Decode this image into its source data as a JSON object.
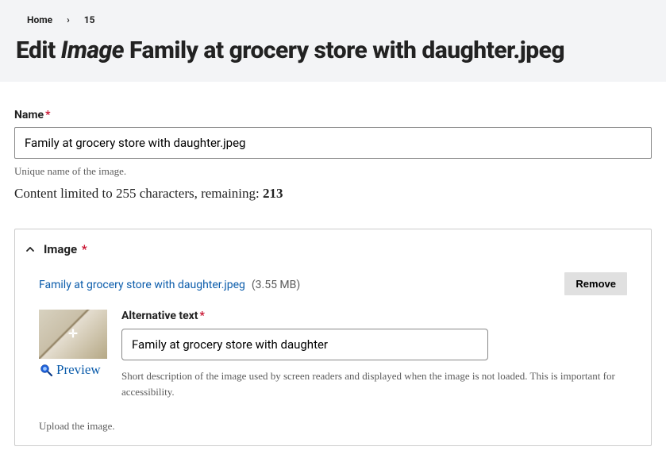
{
  "breadcrumb": {
    "home": "Home",
    "current": "15"
  },
  "page_title": {
    "prefix": "Edit",
    "type": "Image",
    "name": "Family at grocery store with daughter.jpeg"
  },
  "name_field": {
    "label": "Name",
    "value": "Family at grocery store with daughter.jpeg",
    "help": "Unique name of the image.",
    "counter_prefix": "Content limited to 255 characters, remaining: ",
    "remaining": "213"
  },
  "image_panel": {
    "title": "Image",
    "file_link": "Family at grocery store with daughter.jpeg",
    "file_size": "(3.55 MB)",
    "remove_label": "Remove",
    "preview_label": "Preview",
    "alt_label": "Alternative text",
    "alt_value": "Family at grocery store with daughter",
    "alt_help": "Short description of the image used by screen readers and displayed when the image is not loaded. This is important for accessibility.",
    "upload_help": "Upload the image."
  }
}
